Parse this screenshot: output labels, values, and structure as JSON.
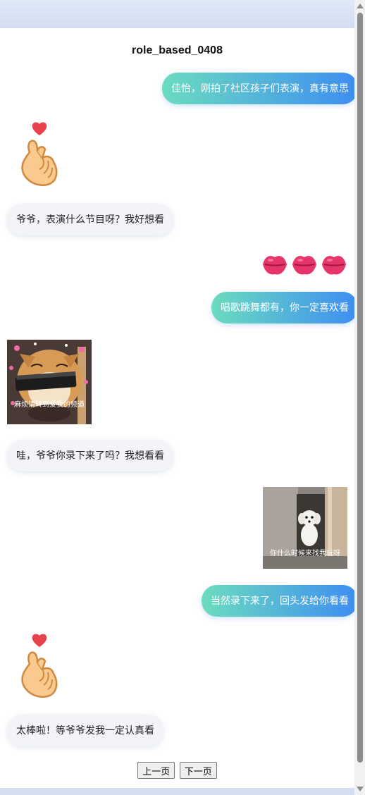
{
  "chat": {
    "title": "role_based_0408",
    "messages": [
      {
        "side": "right",
        "text": "佳怡，刚拍了社区孩子们表演，真有意思"
      },
      {
        "side": "left",
        "sticker": "finger-heart-icon"
      },
      {
        "side": "left",
        "text": "爷爷，表演什么节目呀？我好想看"
      },
      {
        "side": "right",
        "sticker": "kiss-lips-icons"
      },
      {
        "side": "right",
        "text": "唱歌跳舞都有，你一定喜欢看"
      },
      {
        "side": "left",
        "sticker": "shiba-dog-meme",
        "caption": "麻烦请转到爱我的频道"
      },
      {
        "side": "left",
        "text": "哇，爷爷你录下来了吗？我想看看"
      },
      {
        "side": "right",
        "sticker": "puppy-door-meme",
        "caption": "你什么时候来找我玩呀"
      },
      {
        "side": "right",
        "text": "当然录下来了，回头发给你看看"
      },
      {
        "side": "left",
        "sticker": "finger-heart-icon"
      },
      {
        "side": "left",
        "text": "太棒啦！等爷爷发我一定认真看"
      }
    ]
  },
  "pager": {
    "prev": "上一页",
    "next": "下一页"
  },
  "colors": {
    "bubble_gradient_start": "#6bdcbf",
    "bubble_gradient_end": "#3e8df2",
    "left_bubble": "#f2f4f8"
  }
}
